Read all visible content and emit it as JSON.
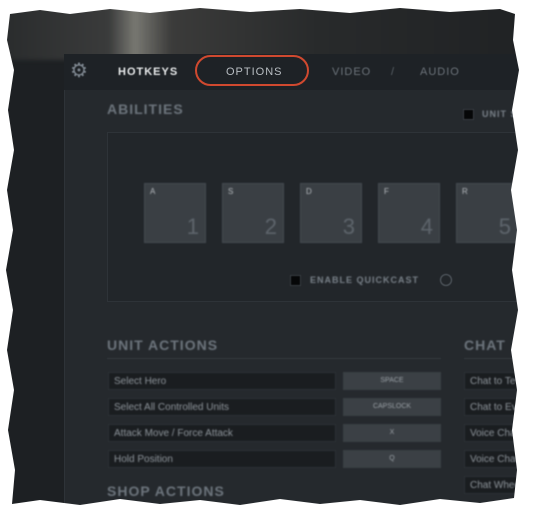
{
  "tabs": {
    "hotkeys": "HOTKEYS",
    "options": "OPTIONS",
    "video": "VIDEO",
    "separator": "/",
    "audio": "AUDIO"
  },
  "abilities": {
    "title": "ABILITIES",
    "unit_specific_label": "UNIT SP",
    "slots": [
      {
        "key": "A",
        "num": "1"
      },
      {
        "key": "S",
        "num": "2"
      },
      {
        "key": "D",
        "num": "3"
      },
      {
        "key": "F",
        "num": "4"
      },
      {
        "key": "R",
        "num": "5"
      }
    ],
    "quickcast_label": "ENABLE QUICKCAST"
  },
  "unit_actions": {
    "title": "UNIT ACTIONS",
    "rows": [
      {
        "label": "Select Hero",
        "key": "SPACE"
      },
      {
        "label": "Select All Controlled Units",
        "key": "CAPSLOCK"
      },
      {
        "label": "Attack Move / Force Attack",
        "key": "X"
      },
      {
        "label": "Hold Position",
        "key": "Q"
      }
    ]
  },
  "shop_actions": {
    "title": "SHOP ACTIONS"
  },
  "chat": {
    "title": "CHAT",
    "rows": [
      "Chat to Te",
      "Chat to Eve",
      "Voice Chat",
      "Voice Chat",
      "Chat Whee"
    ]
  },
  "colors": {
    "highlight": "#d0492f",
    "background": "#1d2023"
  }
}
